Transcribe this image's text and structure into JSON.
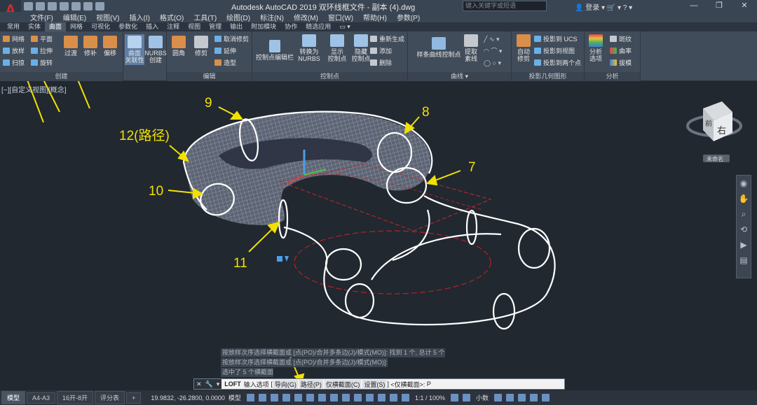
{
  "app": {
    "title": "Autodesk AutoCAD 2019    双环线框文件 - 副本 (4).dwg",
    "search_placeholder": "键入关键字或短语",
    "user": "登录",
    "logo": "A"
  },
  "menu": [
    "文件(F)",
    "编辑(E)",
    "视图(V)",
    "插入(I)",
    "格式(O)",
    "工具(T)",
    "绘图(D)",
    "标注(N)",
    "修改(M)",
    "窗口(W)",
    "帮助(H)",
    "参数(P)"
  ],
  "tabs": [
    "常用",
    "实体",
    "曲面",
    "网格",
    "可视化",
    "参数化",
    "插入",
    "注释",
    "视图",
    "管理",
    "输出",
    "附加模块",
    "协作",
    "精选应用"
  ],
  "active_tab": "曲面",
  "ribbon": {
    "create": {
      "label": "创建",
      "small": [
        "网络",
        "平面",
        "放样",
        "拉伸",
        "扫掠",
        "旋转"
      ],
      "large": [
        "过渡",
        "修补",
        "偏移"
      ]
    },
    "assoc": {
      "l1": "曲面",
      "l2": "关联性",
      "n1": "NURBS",
      "n2": "创建"
    },
    "edit": {
      "label": "编辑",
      "tools": [
        "圆角",
        "修剪"
      ],
      "small": [
        "取消修剪",
        "延伸",
        "造型"
      ]
    },
    "cv": {
      "label": "控制点",
      "bar": "控制点编辑栏",
      "t1a": "转换为",
      "t1b": "NURBS",
      "t2a": "显示",
      "t2b": "控制点",
      "t3a": "隐藏",
      "t3b": "控制点",
      "small": [
        "重新生成",
        "添加",
        "删除"
      ]
    },
    "curve": {
      "label": "曲线",
      "t1": "样条曲线控制点",
      "t2a": "提取",
      "t2b": "素线"
    },
    "proj": {
      "label": "投影几何图形",
      "t1a": "自动",
      "t1b": "修剪",
      "small": [
        "投影到 UCS",
        "投影到视图",
        "投影到两个点"
      ]
    },
    "analysis": {
      "label": "分析",
      "t1a": "分析",
      "t1b": "选项",
      "small": [
        "斑纹",
        "曲率",
        "拔模"
      ]
    }
  },
  "viewport": {
    "label": "[−][自定义视图][概念]",
    "viewcube_face": "右",
    "viewcube_top": "前",
    "unnamed": "未命名"
  },
  "annotations": [
    "12(路径)",
    "9",
    "8",
    "7",
    "10",
    "11"
  ],
  "command_history": [
    "按放样次序选择横截面或 [点(PO)/合并多条边(J)/模式(MO)]: 找到 1 个, 总计 5 个",
    "按放样次序选择横截面或 [点(PO)/合并多条边(J)/模式(MO)]:",
    "选中了 5 个横截面"
  ],
  "command": {
    "name": "LOFT",
    "prompt": "输入选项",
    "opts": [
      "导向(G)",
      "路径(P)",
      "仅横截面(C)",
      "设置(S)"
    ],
    "tail": "<仅横截面>:",
    "input": "P"
  },
  "status": {
    "layouts": [
      "模型",
      "A4-A3",
      "16开-8开",
      "评分表"
    ],
    "coords": "19.9832, -26.2800, 0.0000",
    "model": "模型",
    "scale": "1:1 / 100%",
    "units": "小数"
  }
}
